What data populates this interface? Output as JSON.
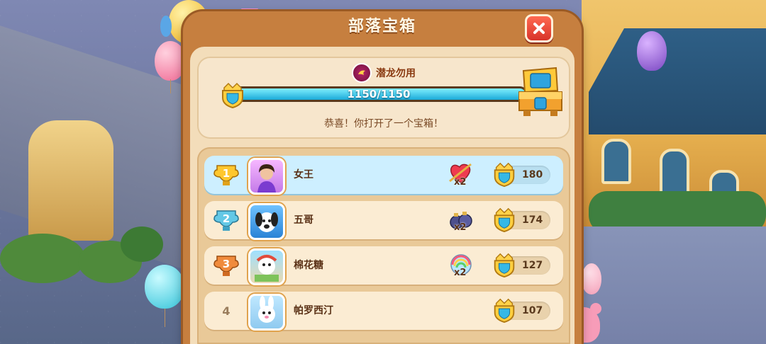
{
  "dialog": {
    "title": "部落宝箱",
    "close_icon": "close-x-icon"
  },
  "progress": {
    "clan_name": "潜龙勿用",
    "current": 1150,
    "max": 1150,
    "label": "1150/1150",
    "message": "恭喜！你打开了一个宝箱！"
  },
  "leaderboard": [
    {
      "rank": "1",
      "name": "女王",
      "item_icon": "heart-arrow-icon",
      "item_count": "x2",
      "score": "180",
      "highlighted": true,
      "medal": "gold"
    },
    {
      "rank": "2",
      "name": "五哥",
      "item_icon": "bomb-icon",
      "item_count": "x2",
      "score": "174",
      "highlighted": false,
      "medal": "silver"
    },
    {
      "rank": "3",
      "name": "棉花糖",
      "item_icon": "rainbow-ball-icon",
      "item_count": "x2",
      "score": "127",
      "highlighted": false,
      "medal": "bronze"
    },
    {
      "rank": "4",
      "name": "帕罗西汀",
      "item_icon": "",
      "item_count": "",
      "score": "107",
      "highlighted": false,
      "medal": "none"
    }
  ],
  "colors": {
    "frame": "#c67f3f",
    "panel": "#f3ddba",
    "highlight_row": "#cdefff",
    "bar_fill": "#1aa9d8",
    "close_button": "#d8332a"
  }
}
